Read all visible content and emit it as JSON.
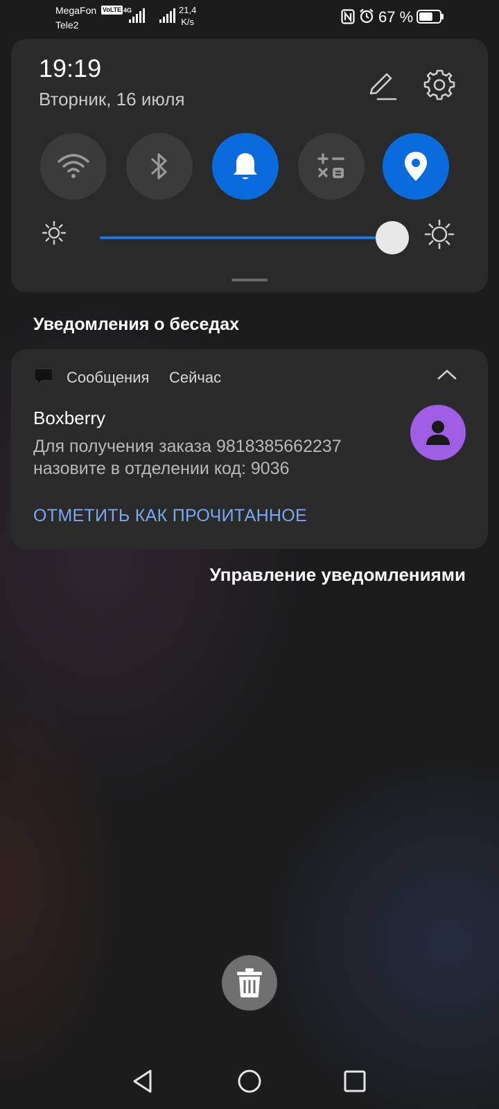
{
  "status_bar": {
    "carrier_1": "MegaFon",
    "volte_badge": "VoLTE",
    "network_type": "4G",
    "carrier_2": "Tele2",
    "speed_value": "21,4",
    "speed_unit": "K/s",
    "battery_text": "67 %",
    "battery_level": 0.67,
    "icons": [
      "signal-icon",
      "nfc-icon",
      "alarm-icon",
      "battery-icon"
    ]
  },
  "quick_panel": {
    "time": "19:19",
    "date": "Вторник, 16 июля",
    "tiles": [
      {
        "name": "wifi",
        "icon": "wifi-icon",
        "active": false
      },
      {
        "name": "bluetooth",
        "icon": "bluetooth-icon",
        "active": false
      },
      {
        "name": "sound",
        "icon": "bell-icon",
        "active": true
      },
      {
        "name": "calculator",
        "icon": "calculator-icon",
        "active": false
      },
      {
        "name": "location",
        "icon": "location-icon",
        "active": true
      }
    ],
    "brightness_level": 0.96
  },
  "notifications": {
    "section_title": "Уведомления о беседах",
    "items": [
      {
        "app_name": "Сообщения",
        "time": "Сейчас",
        "title": "Boxberry",
        "body": "Для получения заказа 9818385662237 назовите в отделении код: 9036",
        "action": "ОТМЕТИТЬ КАК ПРОЧИТАННОЕ"
      }
    ],
    "manage_label": "Управление уведомлениями"
  },
  "colors": {
    "accent_blue": "#0a6cdc",
    "action_text": "#7aa8f2",
    "avatar_purple": "#a05ee4",
    "panel_bg": "#2a2a2b"
  }
}
